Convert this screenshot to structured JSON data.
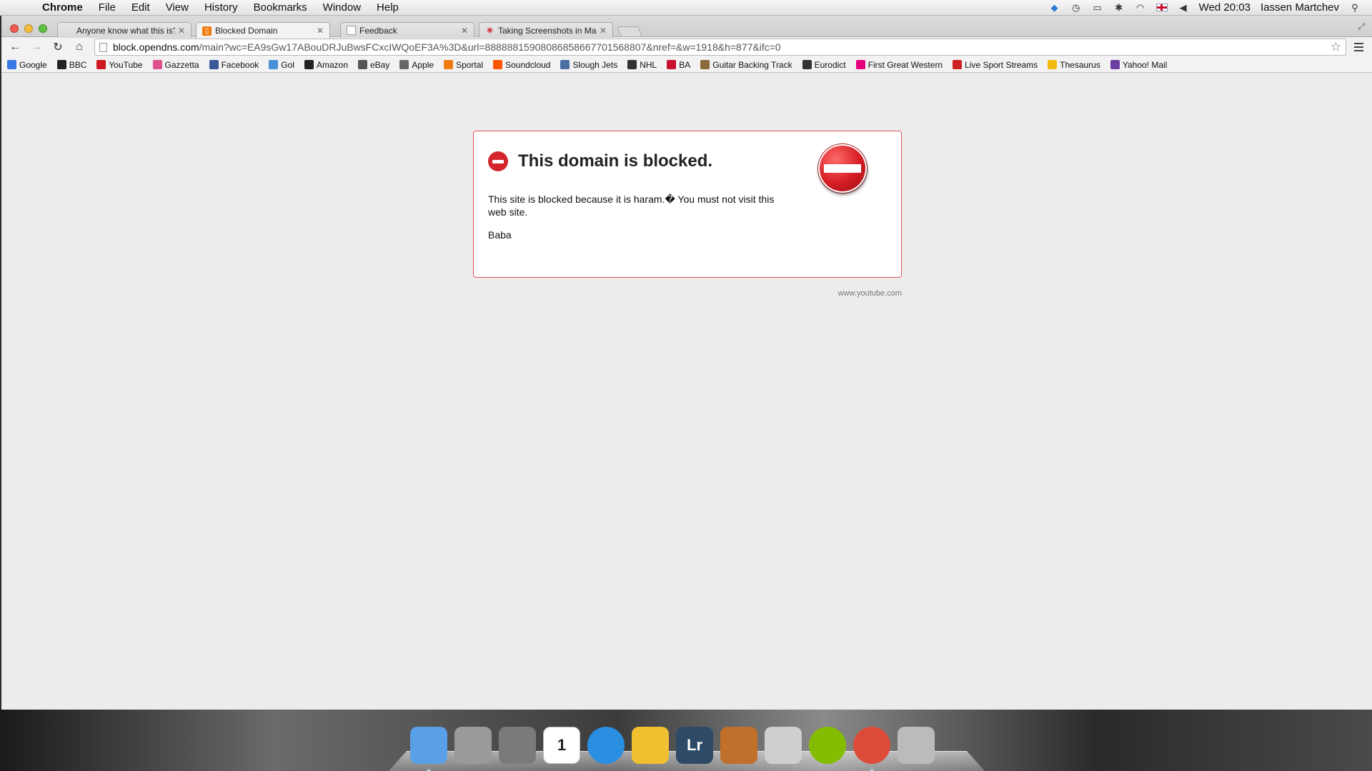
{
  "menubar": {
    "app_name": "Chrome",
    "items": [
      "File",
      "Edit",
      "View",
      "History",
      "Bookmarks",
      "Window",
      "Help"
    ],
    "clock": "Wed 20:03",
    "user": "Iassen Martchev"
  },
  "tabs": [
    {
      "title": "Anyone know what this is?",
      "icon": "apple-icon"
    },
    {
      "title": "Blocked Domain",
      "icon": "opendns-icon",
      "active": true
    },
    {
      "title": "Feedback",
      "icon": "page-icon"
    },
    {
      "title": "Taking Screenshots in Mac",
      "icon": "support-icon"
    }
  ],
  "toolbar": {
    "url_host": "block.opendns.com",
    "url_rest": "/main?wc=EA9sGw17ABouDRJuBwsFCxcIWQoEF3A%3D&url=88888815908086858667701568807&nref=&w=1918&h=877&ifc=0"
  },
  "bookmarks": [
    {
      "label": "Google",
      "icon": "google-icon",
      "color": "#3b78e7"
    },
    {
      "label": "BBC",
      "icon": "bbc-icon",
      "color": "#222222"
    },
    {
      "label": "YouTube",
      "icon": "youtube-icon",
      "color": "#cc181e"
    },
    {
      "label": "Gazzetta",
      "icon": "gazzetta-icon",
      "color": "#e04f8e"
    },
    {
      "label": "Facebook",
      "icon": "facebook-icon",
      "color": "#3b5998"
    },
    {
      "label": "Gol",
      "icon": "gol-icon",
      "color": "#4a8fd8"
    },
    {
      "label": "Amazon",
      "icon": "amazon-icon",
      "color": "#222222"
    },
    {
      "label": "eBay",
      "icon": "ebay-icon",
      "color": "#555555"
    },
    {
      "label": "Apple",
      "icon": "apple-icon",
      "color": "#666666"
    },
    {
      "label": "Sportal",
      "icon": "sportal-icon",
      "color": "#f07a10"
    },
    {
      "label": "Soundcloud",
      "icon": "soundcloud-icon",
      "color": "#ff5500"
    },
    {
      "label": "Slough Jets",
      "icon": "slough-jets-icon",
      "color": "#4a6fa5"
    },
    {
      "label": "NHL",
      "icon": "nhl-icon",
      "color": "#333333"
    },
    {
      "label": "BA",
      "icon": "ba-icon",
      "color": "#c8102e"
    },
    {
      "label": "Guitar Backing Track",
      "icon": "guitar-icon",
      "color": "#8a6a3a"
    },
    {
      "label": "Eurodict",
      "icon": "eurodict-icon",
      "color": "#333333"
    },
    {
      "label": "First Great Western",
      "icon": "fgw-icon",
      "color": "#e5007e"
    },
    {
      "label": "Live Sport Streams",
      "icon": "lss-icon",
      "color": "#cc2222"
    },
    {
      "label": "Thesaurus",
      "icon": "thesaurus-icon",
      "color": "#f2b90f"
    },
    {
      "label": "Yahoo! Mail",
      "icon": "yahoo-mail-icon",
      "color": "#6a3fa0"
    }
  ],
  "block_page": {
    "title": "This domain is blocked.",
    "message": "This site is blocked because it is haram.� You must not visit this web site.",
    "signature": "Baba",
    "domain": "www.youtube.com",
    "accent": "#e3525a"
  },
  "dock": [
    {
      "name": "finder-icon",
      "color": "#5aa0e8"
    },
    {
      "name": "launchpad-icon",
      "color": "#9a9a9a"
    },
    {
      "name": "system-preferences-icon",
      "color": "#7a7a7a"
    },
    {
      "name": "calendar-icon",
      "color": "#ffffff",
      "text": "1"
    },
    {
      "name": "itunes-icon",
      "color": "#2a8fe0"
    },
    {
      "name": "imovie-icon",
      "color": "#f0c030"
    },
    {
      "name": "lightroom-icon",
      "color": "#2e4a66",
      "text": "Lr"
    },
    {
      "name": "garageband-icon",
      "color": "#c0702a"
    },
    {
      "name": "calculator-icon",
      "color": "#cfcfcf"
    },
    {
      "name": "spotify-icon",
      "color": "#84bd00"
    },
    {
      "name": "chrome-icon",
      "color": "#dd4b39"
    },
    {
      "name": "trash-icon",
      "color": "#bbbbbb"
    }
  ]
}
